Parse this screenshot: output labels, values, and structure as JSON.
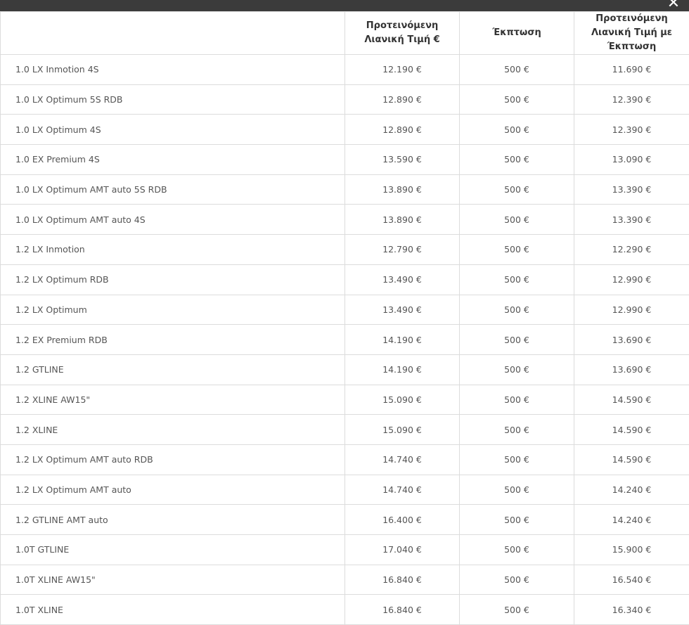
{
  "window": {
    "close_glyph": "✕"
  },
  "table": {
    "headers": [
      "",
      "Προτεινόμενη Λιανική Τιμή €",
      "Έκπτωση",
      "Προτεινόμενη Λιανική Τιμή με Έκπτωση"
    ],
    "rows": [
      [
        "1.0 LX Inmotion 4S",
        "12.190 €",
        "500 €",
        "11.690 €"
      ],
      [
        "1.0 LX Optimum 5S RDB",
        "12.890 €",
        "500 €",
        "12.390 €"
      ],
      [
        "1.0 LX Optimum 4S",
        "12.890 €",
        "500 €",
        "12.390 €"
      ],
      [
        "1.0 EX Premium 4S",
        "13.590 €",
        "500 €",
        "13.090 €"
      ],
      [
        "1.0 LX Optimum AMT auto 5S RDB",
        "13.890 €",
        "500 €",
        "13.390 €"
      ],
      [
        "1.0 LX Optimum AMT auto 4S",
        "13.890 €",
        "500 €",
        "13.390 €"
      ],
      [
        "1.2 LX Inmotion",
        "12.790 €",
        "500 €",
        "12.290 €"
      ],
      [
        "1.2 LX Optimum RDB",
        "13.490 €",
        "500 €",
        "12.990 €"
      ],
      [
        "1.2 LX Optimum",
        "13.490 €",
        "500 €",
        "12.990 €"
      ],
      [
        "1.2 EX Premium RDB",
        "14.190 €",
        "500 €",
        "13.690 €"
      ],
      [
        "1.2 GTLINE",
        "14.190 €",
        "500 €",
        "13.690 €"
      ],
      [
        "1.2 XLINE AW15\"",
        "15.090 €",
        "500 €",
        "14.590 €"
      ],
      [
        "1.2 XLINE",
        "15.090 €",
        "500 €",
        "14.590 €"
      ],
      [
        "1.2 LX Optimum AMT auto RDB",
        "14.740 €",
        "500 €",
        "14.590 €"
      ],
      [
        "1.2 LX Optimum AMT auto",
        "14.740 €",
        "500 €",
        "14.240 €"
      ],
      [
        "1.2 GTLINE AMT auto",
        "16.400 €",
        "500 €",
        "14.240 €"
      ],
      [
        "1.0T GTLINE",
        "17.040 €",
        "500 €",
        "15.900 €"
      ],
      [
        "1.0T XLINE AW15\"",
        "16.840 €",
        "500 €",
        "16.540 €"
      ],
      [
        "1.0T XLINE",
        "16.840 €",
        "500 €",
        "16.340 €"
      ]
    ]
  }
}
